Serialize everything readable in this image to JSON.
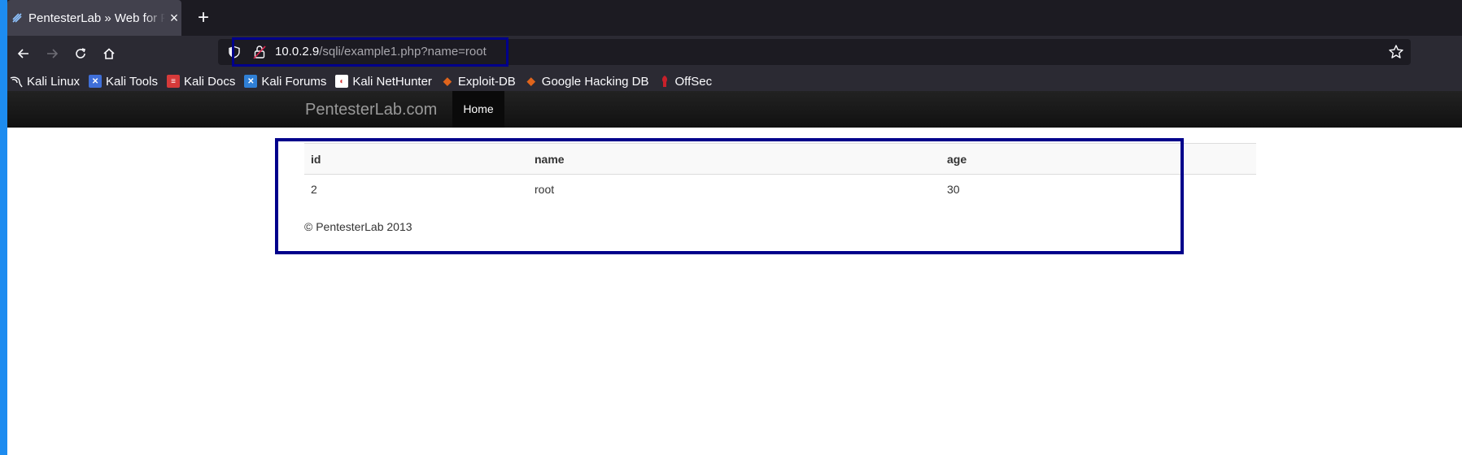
{
  "browser": {
    "tab": {
      "title": "PentesterLab » Web for Pentester",
      "close": "×"
    },
    "new_tab": "+",
    "url": {
      "host": "10.0.2.9",
      "path": "/sqli/example1.php?name=root"
    },
    "bookmarks": [
      {
        "label": "Kali Linux",
        "icon": "kali-dragon-icon",
        "color": "#1c1b22"
      },
      {
        "label": "Kali Tools",
        "icon": "kali-tools-icon",
        "color": "#3f6fd9"
      },
      {
        "label": "Kali Docs",
        "icon": "kali-docs-icon",
        "color": "#d63a3a"
      },
      {
        "label": "Kali Forums",
        "icon": "kali-forums-icon",
        "color": "#2f7fd6"
      },
      {
        "label": "Kali NetHunter",
        "icon": "kali-nethunter-icon",
        "color": "#d43838"
      },
      {
        "label": "Exploit-DB",
        "icon": "exploit-db-icon",
        "color": "#e0641c"
      },
      {
        "label": "Google Hacking DB",
        "icon": "ghdb-icon",
        "color": "#e0641c"
      },
      {
        "label": "OffSec",
        "icon": "offsec-icon",
        "color": "#c8202a"
      }
    ]
  },
  "site": {
    "brand": "PentesterLab.com",
    "nav": {
      "home": "Home"
    },
    "table": {
      "headers": [
        "id",
        "name",
        "age"
      ],
      "rows": [
        [
          "2",
          "root",
          "30"
        ]
      ]
    },
    "footer": "© PentesterLab 2013"
  },
  "colors": {
    "annotation_box": "#00008b",
    "accent_strip": "#1d8cf0"
  }
}
